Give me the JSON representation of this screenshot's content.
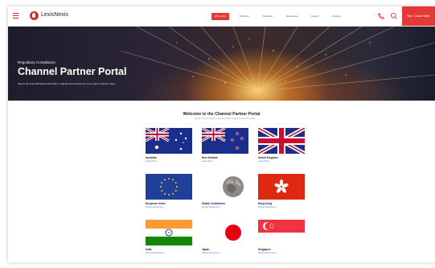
{
  "header": {
    "logo_text": "LexisNexis",
    "nav": [
      "Why Lexis",
      "Products",
      "Solutions",
      "Resources",
      "Events",
      "Support"
    ],
    "cta": "Buy / Contact Sales"
  },
  "hero": {
    "eyebrow": "Regulatory Compliance",
    "title": "Channel Partner Portal",
    "description": "Stay in the loop with latest information, material and services for you to give customer value",
    "colors": {
      "accent": "#e53935",
      "glow": "#ffd678"
    }
  },
  "main": {
    "title": "Welcome to the Channel Partner Portal",
    "subtitle": "Select a region below to access partner resources and information",
    "countries": [
      {
        "name": "Australia",
        "link": "Learn More >",
        "flag": "australia-flag"
      },
      {
        "name": "New Zealand",
        "link": "Learn More >",
        "flag": "new-zealand-flag"
      },
      {
        "name": "United Kingdom",
        "link": "Learn More >",
        "flag": "uk-flag"
      },
      {
        "name": "European Union",
        "link": "Partner Resources >",
        "flag": "eu-flag"
      },
      {
        "name": "Global Jurisdiction",
        "link": "Partner Resources >",
        "flag": "globe-icon"
      },
      {
        "name": "Hong Kong",
        "link": "Partner Resources >",
        "flag": "hong-kong-flag"
      },
      {
        "name": "India",
        "link": "Partner Resources >",
        "flag": "india-flag"
      },
      {
        "name": "Japan",
        "link": "Partner Resources >",
        "flag": "japan-flag"
      },
      {
        "name": "Singapore",
        "link": "Partner Resources >",
        "flag": "singapore-flag"
      }
    ]
  }
}
